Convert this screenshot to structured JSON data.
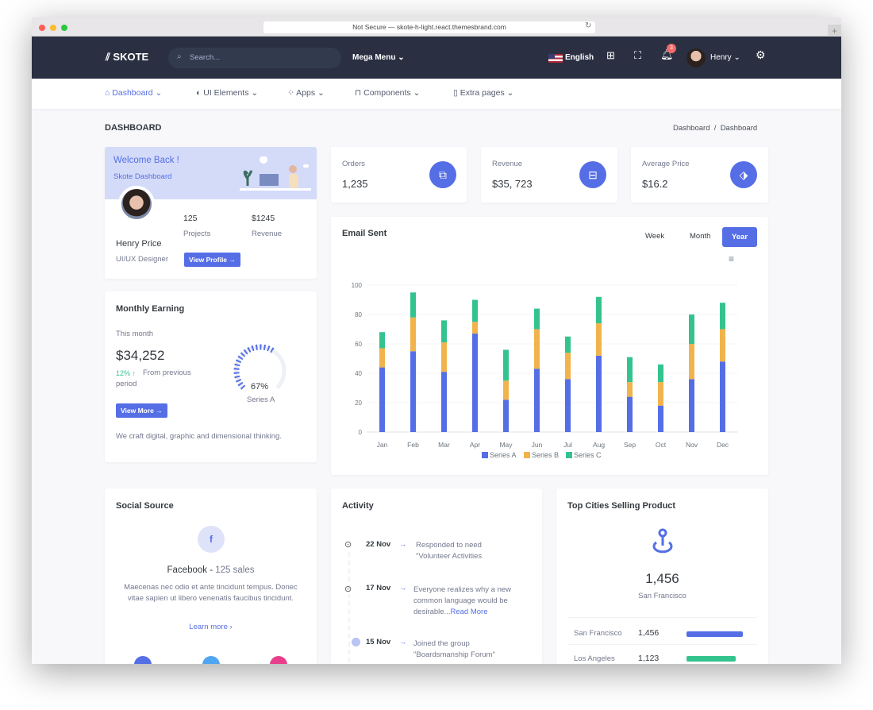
{
  "browser": {
    "url": "Not Secure — skote-h-light.react.themesbrand.com"
  },
  "header": {
    "logo": "SKOTE",
    "search_placeholder": "Search...",
    "mega_menu": "Mega Menu",
    "language": "English",
    "notification_count": "3",
    "user": "Henry"
  },
  "nav": [
    {
      "label": "Dashboard",
      "icon": "home-icon"
    },
    {
      "label": "UI Elements",
      "icon": "tune-icon"
    },
    {
      "label": "Apps",
      "icon": "apps-icon"
    },
    {
      "label": "Components",
      "icon": "briefcase-icon"
    },
    {
      "label": "Extra pages",
      "icon": "file-icon"
    }
  ],
  "page": {
    "title": "DASHBOARD",
    "breadcrumb": [
      "Dashboard",
      "Dashboard"
    ]
  },
  "welcome": {
    "title": "Welcome Back !",
    "subtitle": "Skote Dashboard",
    "name": "Henry Price",
    "role": "UI/UX Designer",
    "projects": "125",
    "projects_label": "Projects",
    "revenue": "$1245",
    "revenue_label": "Revenue",
    "button": "View Profile"
  },
  "stats": [
    {
      "label": "Orders",
      "value": "1,235",
      "icon": "copy-icon"
    },
    {
      "label": "Revenue",
      "value": "$35, 723",
      "icon": "archive-icon"
    },
    {
      "label": "Average Price",
      "value": "$16.2",
      "icon": "tag-icon"
    }
  ],
  "earning": {
    "title": "Monthly Earning",
    "period": "This month",
    "value": "$34,252",
    "change": "12%",
    "change_text": "From previous",
    "change_text2": "period",
    "button": "View More",
    "footer": "We craft digital, graphic and dimensional thinking.",
    "gauge_value": 67,
    "gauge_label": "67%",
    "gauge_series": "Series A"
  },
  "email": {
    "title": "Email Sent",
    "tabs": [
      "Week",
      "Month",
      "Year"
    ],
    "active_tab": "Year"
  },
  "chart_data": {
    "type": "bar",
    "stacked": true,
    "categories": [
      "Jan",
      "Feb",
      "Mar",
      "Apr",
      "May",
      "Jun",
      "Jul",
      "Aug",
      "Sep",
      "Oct",
      "Nov",
      "Dec"
    ],
    "series": [
      {
        "name": "Series A",
        "color": "#556ee6",
        "values": [
          44,
          55,
          41,
          67,
          22,
          43,
          36,
          52,
          24,
          18,
          36,
          48
        ]
      },
      {
        "name": "Series B",
        "color": "#f1b44c",
        "values": [
          13,
          23,
          20,
          8,
          13,
          27,
          18,
          22,
          10,
          16,
          24,
          22
        ]
      },
      {
        "name": "Series C",
        "color": "#34c38f",
        "values": [
          11,
          17,
          15,
          15,
          21,
          14,
          11,
          18,
          17,
          12,
          20,
          18
        ]
      }
    ],
    "ylim": [
      0,
      100
    ],
    "yticks": [
      "0",
      "20",
      "40",
      "60",
      "80",
      "100"
    ],
    "legend": "bottom",
    "grid": true
  },
  "social": {
    "title": "Social Source",
    "platform": "Facebook",
    "sales": "125 sales",
    "text": "Maecenas nec odio et ante tincidunt tempus. Donec vitae sapien ut libero venenatis faucibus tincidunt.",
    "link": "Learn more"
  },
  "activity": {
    "title": "Activity",
    "items": [
      {
        "date": "22 Nov",
        "text": "Responded to need",
        "text2": "\"Volunteer Activities"
      },
      {
        "date": "17 Nov",
        "text": "Everyone realizes why a new",
        "text2": "common language would be",
        "text3": "desirable...",
        "link": "Read More"
      },
      {
        "date": "15 Nov",
        "text": "Joined the group",
        "text2": "\"Boardsmanship Forum\""
      }
    ]
  },
  "cities": {
    "title": "Top Cities Selling Product",
    "value": "1,456",
    "city": "San Francisco",
    "rows": [
      {
        "city": "San Francisco",
        "value": "1,456",
        "pct": 94,
        "color": "#556ee6"
      },
      {
        "city": "Los Angeles",
        "value": "1,123",
        "pct": 82,
        "color": "#34c38f"
      }
    ]
  }
}
